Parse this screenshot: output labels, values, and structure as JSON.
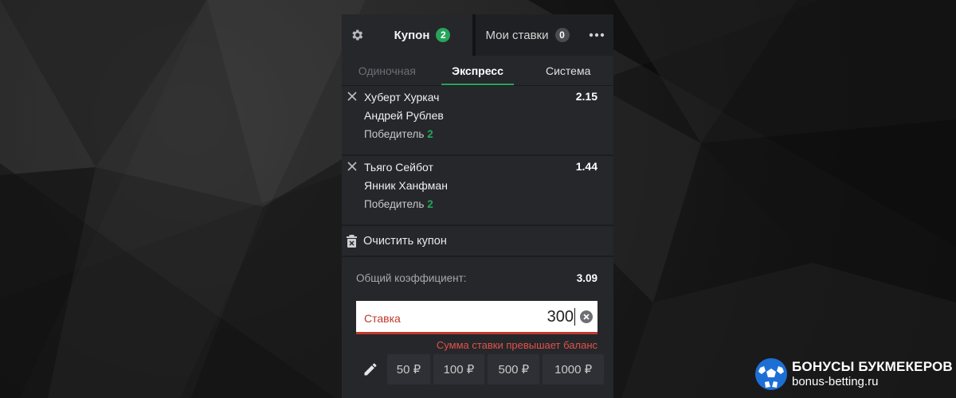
{
  "header": {
    "coupon_label": "Купон",
    "coupon_count": "2",
    "mybets_label": "Мои ставки",
    "mybets_count": "0"
  },
  "bet_types": {
    "single": "Одиночная",
    "express": "Экспресс",
    "system": "Система",
    "active": "express"
  },
  "bets": [
    {
      "player1": "Хуберт Хуркач",
      "player2": "Андрей Рублев",
      "market": "Победитель",
      "outcome": "2",
      "odd": "2.15"
    },
    {
      "player1": "Тьяго Сейбот",
      "player2": "Янник Ханфман",
      "market": "Победитель",
      "outcome": "2",
      "odd": "1.44"
    }
  ],
  "clear_label": "Очистить купон",
  "total": {
    "label": "Общий коэффициент:",
    "value": "3.09"
  },
  "stake": {
    "label": "Ставка",
    "value": "300",
    "error": "Сумма ставки превышает баланс"
  },
  "quick_amounts": [
    "50 ₽",
    "100 ₽",
    "500 ₽",
    "1000 ₽"
  ],
  "brand": {
    "title": "БОНУСЫ БУКМЕКЕРОВ",
    "site": "bonus-betting.ru"
  },
  "colors": {
    "accent": "#27a55a",
    "error": "#c0392b",
    "panel": "#26272b"
  },
  "icons": [
    "gear-icon",
    "more-icon",
    "close-icon",
    "trash-icon",
    "clear-input-icon",
    "pencil-icon",
    "soccer-ball-icon"
  ]
}
